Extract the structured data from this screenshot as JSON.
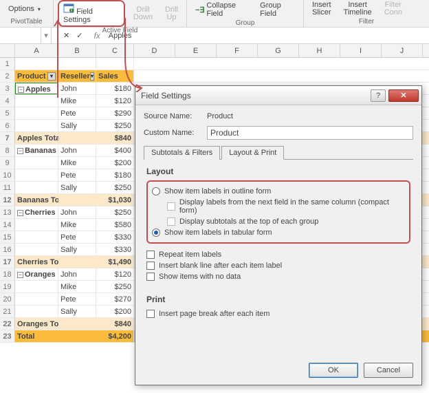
{
  "ribbon": {
    "options": "Options",
    "pivottable": "PivotTable",
    "field_settings": "Field Settings",
    "drill_down": "Drill\nDown",
    "drill_up": "Drill\nUp",
    "collapse_field": "Collapse Field",
    "active_field": "Active Field",
    "group_field": "Group Field",
    "group": "Group",
    "insert_slicer": "Insert\nSlicer",
    "insert_timeline": "Insert\nTimeline",
    "filter_conn": "Filter\nConn",
    "filter": "Filter"
  },
  "formula": {
    "name": "",
    "fx": "fx",
    "value": "Apples"
  },
  "columns": [
    "",
    "A",
    "B",
    "C",
    "D",
    "E",
    "F",
    "G",
    "H",
    "I",
    "J"
  ],
  "pivot": {
    "headers": [
      "Product",
      "Reseller",
      "Sales"
    ],
    "groups": [
      {
        "name": "Apples",
        "rows": [
          [
            "John",
            "$180"
          ],
          [
            "Mike",
            "$120"
          ],
          [
            "Pete",
            "$290"
          ],
          [
            "Sally",
            "$250"
          ]
        ],
        "total_label": "Apples Total",
        "total": "$840"
      },
      {
        "name": "Bananas",
        "rows": [
          [
            "John",
            "$400"
          ],
          [
            "Mike",
            "$200"
          ],
          [
            "Pete",
            "$180"
          ],
          [
            "Sally",
            "$250"
          ]
        ],
        "total_label": "Bananas Total",
        "total": "$1,030"
      },
      {
        "name": "Cherries",
        "rows": [
          [
            "John",
            "$250"
          ],
          [
            "Mike",
            "$580"
          ],
          [
            "Pete",
            "$330"
          ],
          [
            "Sally",
            "$330"
          ]
        ],
        "total_label": "Cherries Total",
        "total": "$1,490"
      },
      {
        "name": "Oranges",
        "rows": [
          [
            "John",
            "$120"
          ],
          [
            "Mike",
            "$250"
          ],
          [
            "Pete",
            "$270"
          ],
          [
            "Sally",
            "$200"
          ]
        ],
        "total_label": "Oranges Total",
        "total": "$840"
      }
    ],
    "grand_label": "Total",
    "grand_total": "$4,200"
  },
  "dialog": {
    "title": "Field Settings",
    "source_label": "Source Name:",
    "source_value": "Product",
    "custom_label": "Custom Name:",
    "custom_value": "Product",
    "tab1": "Subtotals & Filters",
    "tab2": "Layout & Print",
    "layout": "Layout",
    "opt_outline": "Show item labels in outline form",
    "opt_compact": "Display labels from the next field in the same column (compact form)",
    "opt_subtop": "Display subtotals at the top of each group",
    "opt_tabular": "Show item labels in tabular form",
    "chk_repeat": "Repeat item labels",
    "chk_blank": "Insert blank line after each item label",
    "chk_nodata": "Show items with no data",
    "print": "Print",
    "chk_pagebreak": "Insert page break after each item",
    "ok": "OK",
    "cancel": "Cancel"
  }
}
